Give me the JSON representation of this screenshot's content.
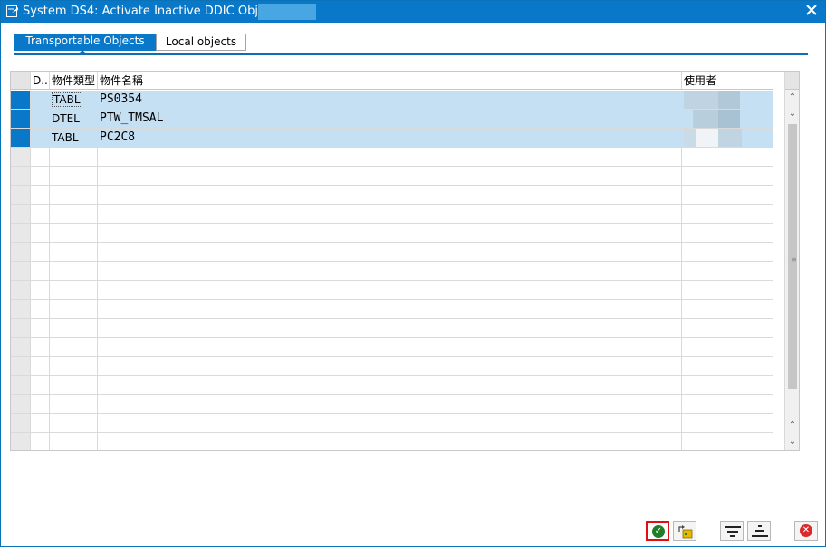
{
  "window": {
    "title": "System DS4: Activate Inactive DDIC Objects of",
    "close_icon": "close-icon"
  },
  "tabs": [
    {
      "label": "Transportable Objects",
      "active": true
    },
    {
      "label": "Local objects",
      "active": false
    }
  ],
  "table": {
    "columns": {
      "d": "D..",
      "type": "物件類型",
      "name": "物件名稱",
      "user": "使用者"
    },
    "rows": [
      {
        "type": "TABL",
        "name": "PS0354"
      },
      {
        "type": "DTEL",
        "name": "PTW_TMSAL"
      },
      {
        "type": "TABL",
        "name": "PC2C8"
      }
    ]
  },
  "footer": {
    "icons": [
      "check-icon",
      "generate-icon",
      "filter-icon",
      "sort-icon",
      "cancel-icon"
    ]
  },
  "colors": {
    "accent": "#0a78c8",
    "row_highlight": "#c5e0f3",
    "ok_border": "#e01010"
  }
}
